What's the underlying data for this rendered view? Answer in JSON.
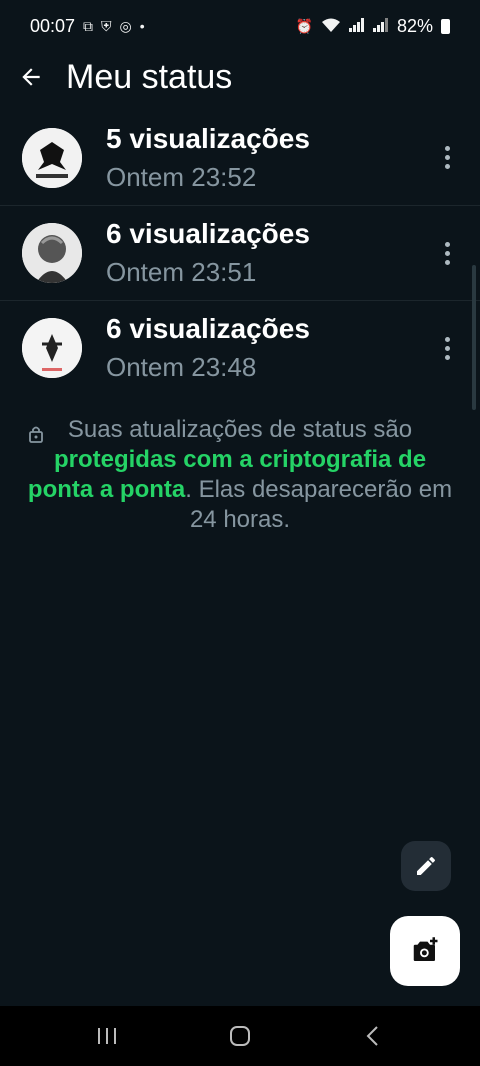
{
  "status_bar": {
    "time": "00:07",
    "battery": "82%"
  },
  "header": {
    "title": "Meu status"
  },
  "statuses": [
    {
      "views": "5 visualizações",
      "time": "Ontem 23:52"
    },
    {
      "views": "6 visualizações",
      "time": "Ontem 23:51"
    },
    {
      "views": "6 visualizações",
      "time": "Ontem 23:48"
    }
  ],
  "info": {
    "text_before": "Suas atualizações de status são ",
    "highlight": "protegidas com a criptografia de ponta a ponta",
    "text_after": ". Elas desaparecerão em 24 horas."
  },
  "colors": {
    "background": "#0b141a",
    "accent": "#25d366",
    "secondary_text": "#8696a0"
  },
  "icons": {
    "back": "arrow-left-icon",
    "more": "more-vert-icon",
    "lock": "lock-icon",
    "edit": "pencil-icon",
    "camera": "camera-add-icon"
  }
}
